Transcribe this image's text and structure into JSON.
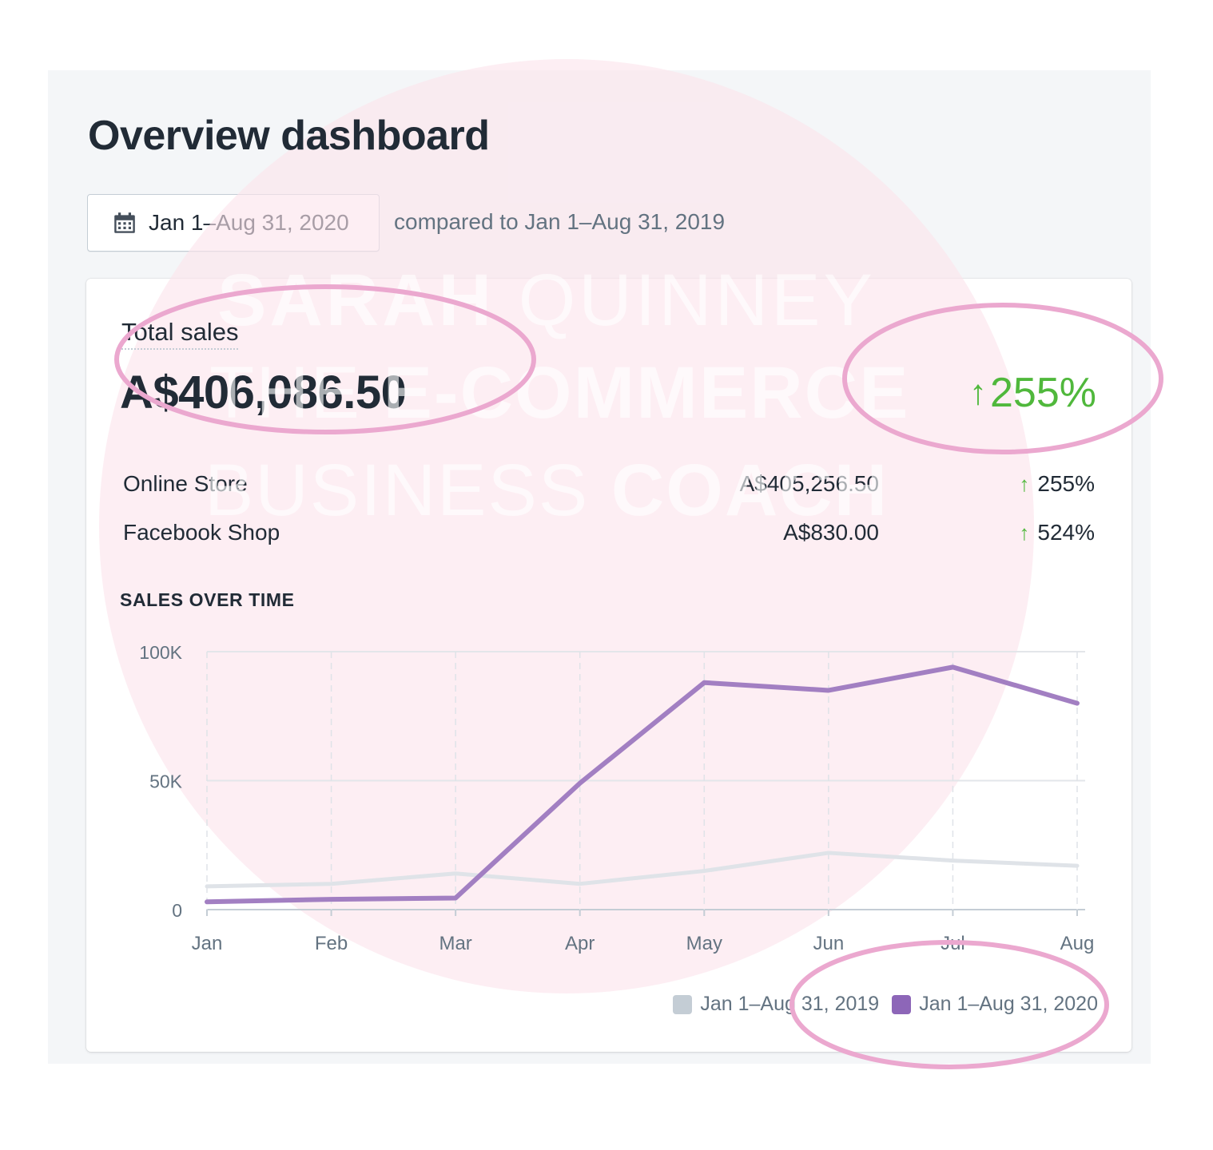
{
  "page": {
    "title": "Overview dashboard"
  },
  "date_range": {
    "icon": "calendar-icon",
    "label": "Jan 1–Aug 31, 2020",
    "compare_text": "compared to Jan 1–Aug 31, 2019"
  },
  "total_sales": {
    "label": "Total sales",
    "value": "A$406,086.50",
    "change": "255%",
    "change_direction": "up",
    "change_color": "#50b83c"
  },
  "channels": [
    {
      "name": "Online Store",
      "amount": "A$405,256.50",
      "change": "255%"
    },
    {
      "name": "Facebook Shop",
      "amount": "A$830.00",
      "change": "524%"
    }
  ],
  "sales_over_time": {
    "title": "SALES OVER TIME"
  },
  "watermark": {
    "line1_bold": "SARAH",
    "line1_thin": "QUINNEY",
    "line2_thin": "THE",
    "line2_bold": "E-COMMERCE",
    "line3_thin": "BUSINESS",
    "line3_bold": "COACH"
  },
  "chart_data": {
    "type": "line",
    "title": "SALES OVER TIME",
    "categories": [
      "Jan",
      "Feb",
      "Mar",
      "Apr",
      "May",
      "Jun",
      "Jul",
      "Aug"
    ],
    "y_ticks": [
      "100K",
      "50K",
      "0"
    ],
    "ylim": [
      0,
      100000
    ],
    "grid": true,
    "legend_position": "bottom-right",
    "series": [
      {
        "name": "Jan 1–Aug 31, 2019",
        "color": "#dfe3e8",
        "legend_color": "#c4cdd5",
        "values": [
          9000,
          10000,
          14000,
          10000,
          15000,
          22000,
          19000,
          17000
        ]
      },
      {
        "name": "Jan 1–Aug 31, 2020",
        "color": "#9c6ade",
        "legend_color": "#8d66b8",
        "line_color": "#a27fc2",
        "values": [
          3000,
          4000,
          4500,
          49000,
          88000,
          85000,
          94000,
          80000
        ]
      }
    ]
  },
  "colors": {
    "annotation": "#eba8cf",
    "watermark_circle": "#fce4ec"
  }
}
